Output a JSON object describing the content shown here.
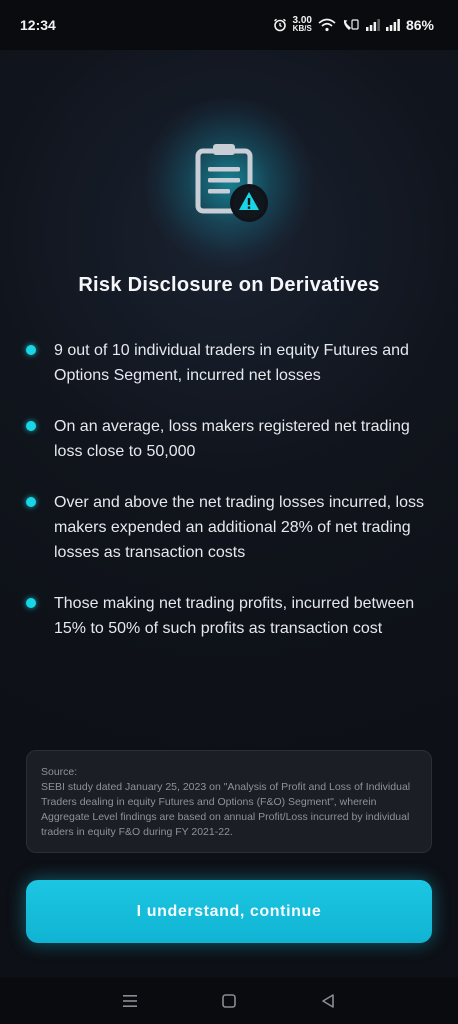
{
  "status_bar": {
    "time": "12:34",
    "net_speed_value": "3.00",
    "net_speed_unit": "KB/S",
    "battery": "86%",
    "icons": [
      "alarm-icon",
      "wifi-icon",
      "volte-call-icon",
      "signal-icon",
      "signal-icon",
      "battery-text"
    ]
  },
  "header": {
    "icon": "clipboard-warning-icon",
    "title": "Risk Disclosure on Derivatives"
  },
  "disclosures": [
    "9 out of 10 individual traders in equity Futures and Options Segment, incurred net losses",
    "On an average, loss makers registered net trading loss close to 50,000",
    "Over and above the net trading losses incurred, loss makers expended an additional 28% of net trading losses as transaction costs",
    "Those making net trading profits, incurred between 15% to 50% of such profits as transaction cost"
  ],
  "source": {
    "label": "Source:",
    "text": "SEBI study dated January 25, 2023 on \"Analysis of Profit and Loss of Individual Traders dealing in equity Futures and Options (F&O) Segment\", wherein Aggregate Level findings are based on annual Profit/Loss incurred by individual traders in equity F&O during FY 2021-22."
  },
  "cta": {
    "label": "I understand, continue"
  },
  "nav": [
    "menu-icon",
    "home-icon",
    "back-icon"
  ],
  "colors": {
    "accent": "#19d6e6",
    "button": "#10b4d2",
    "background": "#10141c"
  }
}
